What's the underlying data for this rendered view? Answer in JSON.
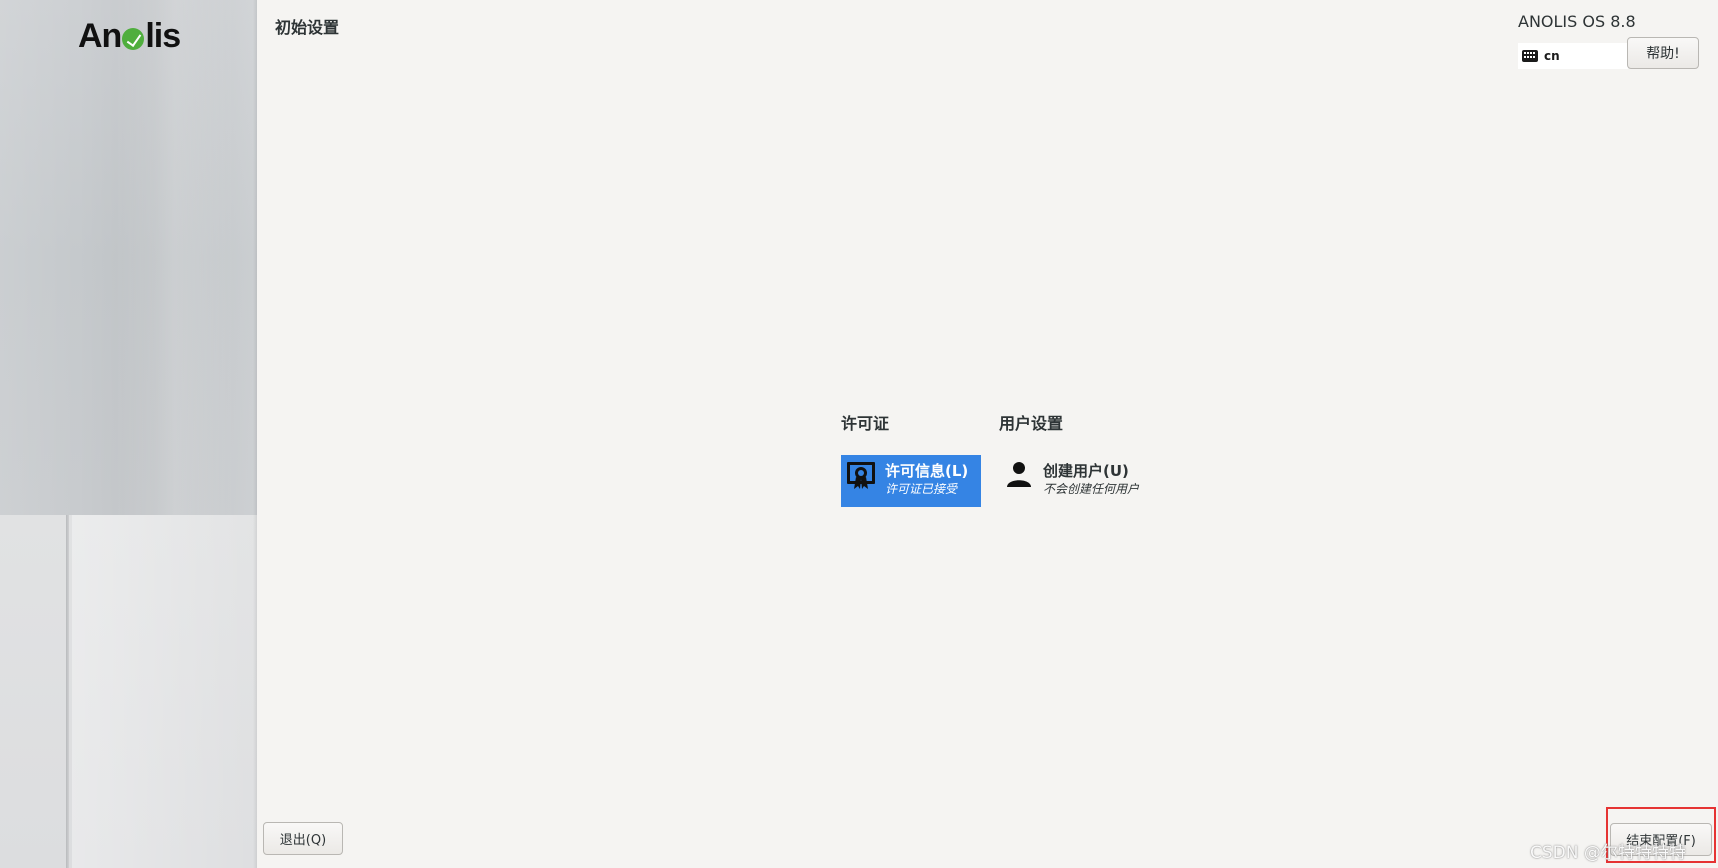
{
  "sidebar": {
    "logo_text_left": "An",
    "logo_text_right": "lis"
  },
  "header": {
    "title": "初始设置",
    "os_name": "ANOLIS OS 8.8",
    "keyboard_layout": "cn",
    "help_label": "帮助!"
  },
  "hub": {
    "categories": [
      {
        "title": "许可证",
        "spokes": [
          {
            "title": "许可信息(L)",
            "status": "许可证已接受",
            "icon": "license-certificate-icon",
            "selected": true
          }
        ]
      },
      {
        "title": "用户设置",
        "spokes": [
          {
            "title": "创建用户(U)",
            "status": "不会创建任何用户",
            "icon": "user-icon",
            "selected": false
          }
        ]
      }
    ]
  },
  "footer": {
    "quit_label": "退出(Q)",
    "finish_label": "结束配置(F)"
  },
  "watermark": "CSDN @尔特特特特",
  "colors": {
    "accent": "#3584e4",
    "background": "#f5f4f2",
    "highlight": "#e53333"
  }
}
